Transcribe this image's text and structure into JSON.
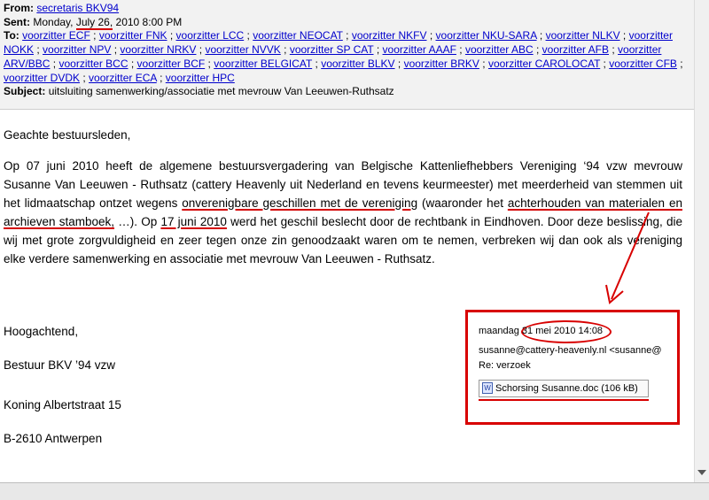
{
  "header": {
    "from_label": "From:",
    "from_value": "secretaris BKV94",
    "sent_label": "Sent:",
    "sent_prefix": "Monday,",
    "sent_date": "July 26,",
    "sent_rest": "2010 8:00 PM",
    "to_label": "To:",
    "recipients": [
      "voorzitter ECF",
      "voorzitter FNK",
      "voorzitter LCC",
      "voorzitter NEOCAT",
      "voorzitter NKFV",
      "voorzitter NKU-SARA",
      "voorzitter NLKV",
      "voorzitter NOKK",
      "voorzitter NPV",
      "voorzitter NRKV",
      "voorzitter NVVK",
      "voorzitter SP CAT",
      "voorzitter AAAF",
      "voorzitter ABC",
      "voorzitter AFB",
      "voorzitter ARV/BBC",
      "voorzitter BCC",
      "voorzitter BCF",
      "voorzitter BELGICAT",
      "voorzitter BLKV",
      "voorzitter BRKV",
      "voorzitter CAROLOCAT",
      "voorzitter CFB",
      "voorzitter DVDK",
      "voorzitter ECA",
      "voorzitter HPC"
    ],
    "subject_label": "Subject:",
    "subject_value": "uitsluiting samenwerking/associatie met mevrouw Van Leeuwen-Ruthsatz"
  },
  "body": {
    "greeting": "Geachte bestuursleden,",
    "p1_a": "Op 07 juni 2010 heeft de algemene bestuursvergadering van Belgische Kattenliefhebbers Vereniging ‘94 vzw mevrouw Susanne Van Leeuwen - Ruthsatz (cattery Heavenly uit Nederland en tevens keurmeester) met meerderheid van stemmen uit het lidmaatschap ontzet wegens ",
    "p1_u1": "onverenigbare geschillen met de vereniging",
    "p1_b": " (waaronder het ",
    "p1_u2": "achterhouden van materialen en archieven stamboek,",
    "p1_c": " …).  Op ",
    "p1_u3": "17 juni 2010",
    "p1_d": " werd het geschil beslecht door de rechtbank in Eindhoven.  Door deze beslissing, die wij met grote zorgvuldigheid en zeer tegen onze zin genoodzaakt waren om te nemen, verbreken wij dan ook als vereniging elke verdere samenwerking en associatie met mevrouw Van Leeuwen - Ruthsatz."
  },
  "closing": {
    "line1": "Hoogachtend,",
    "line2": "Bestuur BKV ’94 vzw",
    "line3": "Koning Albertstraat 15",
    "line4": "B-2610 Antwerpen"
  },
  "attachment": {
    "date_line": "maandag 31 mei 2010 14:08",
    "from_line": "susanne@cattery-heavenly.nl <susanne@",
    "subject_line": "Re: verzoek",
    "file_line": "Schorsing Susanne.doc (106 kB)",
    "icon": "word-doc-icon"
  },
  "colors": {
    "highlight": "#d80000",
    "link": "#0000cc"
  }
}
